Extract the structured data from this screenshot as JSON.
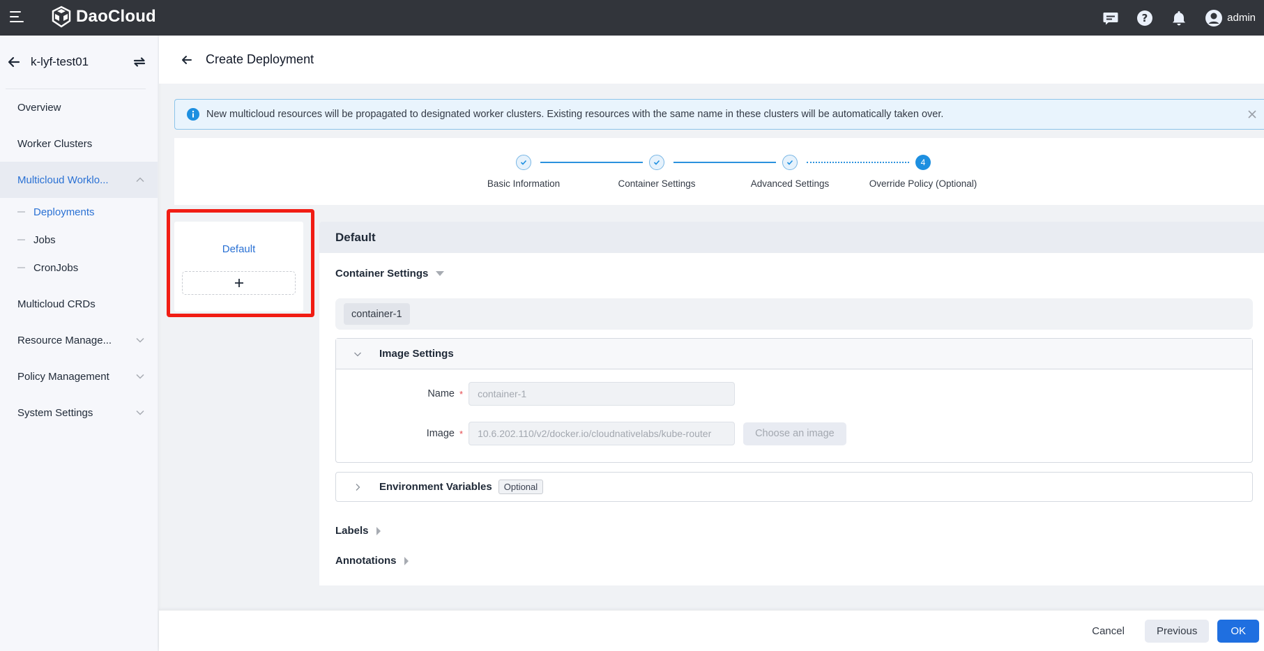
{
  "topbar": {
    "brand": "DaoCloud",
    "user_name": "admin",
    "icons": [
      "menu-icon",
      "message-icon",
      "help-icon",
      "bell-icon",
      "user-avatar-icon"
    ]
  },
  "sidebar": {
    "workspace": "k-lyf-test01",
    "items": [
      {
        "label": "Overview",
        "expandable": false
      },
      {
        "label": "Worker Clusters",
        "expandable": false
      },
      {
        "label": "Multicloud Worklo...",
        "expandable": true,
        "expanded": true,
        "active": true
      },
      {
        "label": "Multicloud CRDs",
        "expandable": false
      },
      {
        "label": "Resource Manage...",
        "expandable": true,
        "expanded": false
      },
      {
        "label": "Policy Management",
        "expandable": true,
        "expanded": false
      },
      {
        "label": "System Settings",
        "expandable": true,
        "expanded": false
      }
    ],
    "sub_items": [
      {
        "label": "Deployments",
        "active": true
      },
      {
        "label": "Jobs",
        "active": false
      },
      {
        "label": "CronJobs",
        "active": false
      }
    ]
  },
  "page": {
    "title": "Create Deployment"
  },
  "alert": {
    "text": "New multicloud resources will be propagated to designated worker clusters. Existing resources with the same name in these clusters will be automatically taken over."
  },
  "steps": [
    {
      "label": "Basic Information",
      "status": "done"
    },
    {
      "label": "Container Settings",
      "status": "done"
    },
    {
      "label": "Advanced Settings",
      "status": "done"
    },
    {
      "label": "Override Policy (Optional)",
      "status": "current",
      "number": "4"
    }
  ],
  "policy_list": {
    "items": [
      "Default"
    ],
    "add_label": "+"
  },
  "panel": {
    "title": "Default",
    "container_settings_label": "Container Settings",
    "containers": [
      "container-1"
    ],
    "image_settings": {
      "title": "Image Settings",
      "name_label": "Name",
      "name_value": "container-1",
      "image_label": "Image",
      "image_value": "10.6.202.110/v2/docker.io/cloudnativelabs/kube-router",
      "choose_image_label": "Choose an image"
    },
    "env_vars": {
      "title": "Environment Variables",
      "badge": "Optional"
    },
    "labels_label": "Labels",
    "annotations_label": "Annotations"
  },
  "footer": {
    "cancel": "Cancel",
    "previous": "Previous",
    "ok": "OK"
  },
  "colors": {
    "primary": "#1f6fe0",
    "link": "#2a71d4",
    "topbar": "#32353b",
    "highlight": "#f11d14",
    "step": "#1d8fe0"
  }
}
